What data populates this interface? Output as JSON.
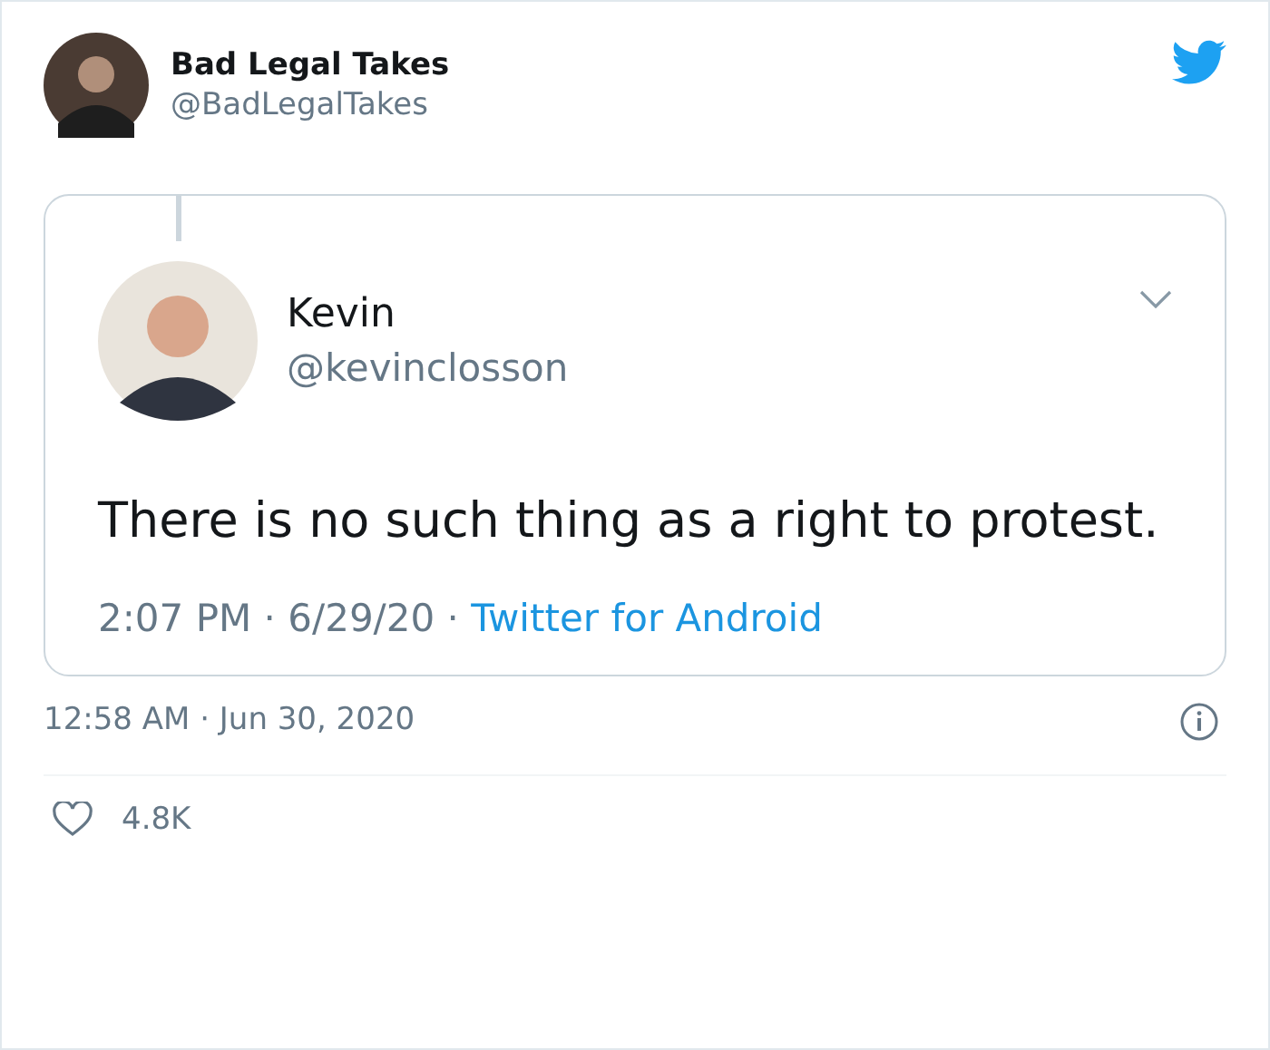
{
  "author": {
    "name": "Bad Legal Takes",
    "handle": "@BadLegalTakes"
  },
  "quoted_tweet": {
    "author": {
      "name": "Kevin",
      "handle": "@kevinclosson"
    },
    "text": "There is no such thing as a right to protest.",
    "timestamp": "2:07 PM · 6/29/20 ·",
    "source": "Twitter for Android"
  },
  "timestamp": "12:58 AM · Jun 30, 2020",
  "likes": "4.8K"
}
